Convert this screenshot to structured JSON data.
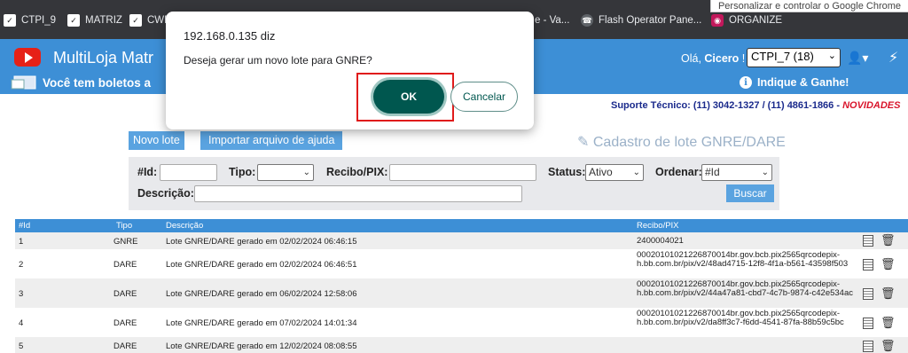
{
  "browser": {
    "bookmarks": [
      {
        "label": "CTPI_9",
        "icon": "bookmark-icon"
      },
      {
        "label": "MATRIZ",
        "icon": "bookmark-icon"
      },
      {
        "label": "CWB",
        "icon": "bookmark-icon"
      },
      {
        "label": "e - Va...",
        "icon": "bookmark-icon"
      },
      {
        "label": "Flash Operator Pane...",
        "icon": "phone-icon"
      },
      {
        "label": "ORGANIZE",
        "icon": "organize-icon"
      }
    ],
    "tooltip": "Personalizar e controlar o Google Chrome"
  },
  "header": {
    "app_title": "MultiLoja Matr",
    "greeting": "Olá, ",
    "user_name": "Cicero",
    "greeting_suffix": " !",
    "store_selected": "CTPI_7 (18)",
    "boleto_notice": "Você tem boletos a",
    "indique_label": "Indique & Ganhe!",
    "brand_color": "#3d8fd6"
  },
  "support": {
    "text": "Suporte Técnico: (11) 3042-1327 / (11) 4861-1866 - ",
    "novidades": "NOVIDADES"
  },
  "toolbar": {
    "novo_lote": "Novo lote",
    "importar": "Importar arquivo de ajuda",
    "page_heading": "Cadastro de lote GNRE/DARE"
  },
  "filters": {
    "id_label": "#Id:",
    "tipo_label": "Tipo:",
    "recibo_label": "Recibo/PIX:",
    "status_label": "Status:",
    "status_value": "Ativo",
    "ordenar_label": "Ordenar:",
    "ordenar_value": "#Id",
    "descricao_label": "Descrição:",
    "buscar": "Buscar"
  },
  "table": {
    "headers": [
      "#Id",
      "Tipo",
      "Descrição",
      "Recibo/PIX"
    ],
    "rows": [
      {
        "id": "1",
        "tipo": "GNRE",
        "descricao": "Lote GNRE/DARE gerado em 02/02/2024 06:46:15",
        "recibo": "2400004021"
      },
      {
        "id": "2",
        "tipo": "DARE",
        "descricao": "Lote GNRE/DARE gerado em 02/02/2024 06:46:51",
        "recibo": "00020101021226870014br.gov.bcb.pix2565qrcodepix-h.bb.com.br/pix/v2/48ad4715-12f8-4f1a-b561-43598f503"
      },
      {
        "id": "3",
        "tipo": "DARE",
        "descricao": "Lote GNRE/DARE gerado em 06/02/2024 12:58:06",
        "recibo": "00020101021226870014br.gov.bcb.pix2565qrcodepix-h.bb.com.br/pix/v2/44a47a81-cbd7-4c7b-9874-c42e534ac"
      },
      {
        "id": "4",
        "tipo": "DARE",
        "descricao": "Lote GNRE/DARE gerado em 07/02/2024 14:01:34",
        "recibo": "00020101021226870014br.gov.bcb.pix2565qrcodepix-h.bb.com.br/pix/v2/da8ff3c7-f6dd-4541-87fa-88b59c5bc"
      },
      {
        "id": "5",
        "tipo": "DARE",
        "descricao": "Lote GNRE/DARE gerado em 12/02/2024 08:08:55",
        "recibo": ""
      }
    ]
  },
  "dialog": {
    "title": "192.168.0.135 diz",
    "message": "Deseja gerar um novo lote para GNRE?",
    "ok": "OK",
    "cancel": "Cancelar"
  }
}
